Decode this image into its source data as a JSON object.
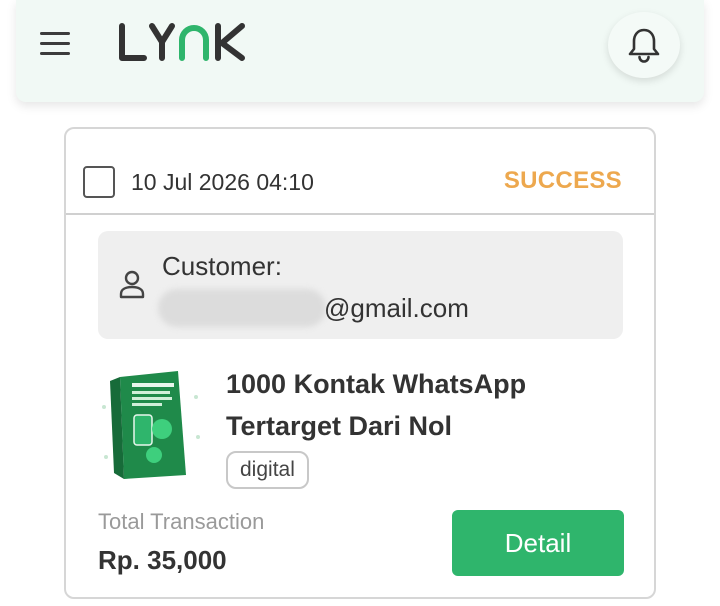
{
  "header": {
    "brand": "LYNK",
    "menu_icon": "hamburger-menu-icon",
    "notification_icon": "bell-icon",
    "accent_color": "#2fb56c"
  },
  "transaction": {
    "date": "10 Jul 2026 04:10",
    "status": "SUCCESS",
    "status_color": "#eda84e",
    "customer_label": "Customer:",
    "customer_email_visible": "@gmail.com",
    "product_title": "1000 Kontak WhatsApp Tertarget Dari Nol",
    "product_tag": "digital",
    "total_label": "Total Transaction",
    "total_value": "Rp. 35,000",
    "detail_button": "Detail"
  }
}
